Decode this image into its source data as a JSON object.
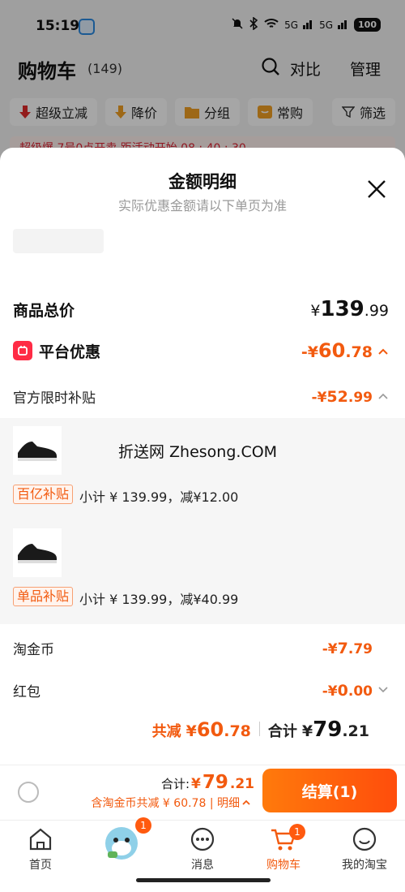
{
  "status_bar": {
    "time": "15:19",
    "battery": "100",
    "network_1": "5G",
    "network_2": "5G"
  },
  "cart_header": {
    "title": "购物车",
    "count": "(149)",
    "compare": "对比",
    "manage": "管理"
  },
  "filters": [
    {
      "label": "超级立减",
      "icon": "arrow-down-icon",
      "color": "#e02a2a"
    },
    {
      "label": "降价",
      "icon": "price-down-icon",
      "color": "#f2a024"
    },
    {
      "label": "分组",
      "icon": "folder-icon",
      "color": "#f2a024"
    },
    {
      "label": "常购",
      "icon": "frequent-icon",
      "color": "#f2a024"
    },
    {
      "label": "筛选",
      "icon": "filter-icon",
      "color": "#333333"
    }
  ],
  "promo_strip": {
    "text": "超级爆 7号0点开卖 距活动开始 08 : 40 : 30"
  },
  "sheet": {
    "title": "金额明细",
    "subtitle": "实际优惠金额请以下单页为准",
    "goods_total": {
      "label": "商品总价",
      "currency": "¥",
      "integer": "139",
      "decimal": ".99"
    },
    "platform_discount": {
      "label": "平台优惠",
      "sign": "-¥",
      "integer": "60",
      "decimal": ".78"
    },
    "official_subsidy": {
      "label": "官方限时补贴",
      "sign": "-¥",
      "integer": "52",
      "decimal": ".99"
    },
    "items": [
      {
        "tag": "百亿补贴",
        "text": "小计 ¥ 139.99，减¥12.00"
      },
      {
        "tag": "单品补贴",
        "text": "小计 ¥ 139.99，减¥40.99"
      }
    ],
    "watermark": "折送网 Zhesong.COM",
    "taojinbi": {
      "label": "淘金币",
      "sign": "-¥",
      "integer": "7",
      "decimal": ".79"
    },
    "red_packet": {
      "label": "红包",
      "sign": "-¥",
      "integer": "0",
      "decimal": ".00"
    },
    "totals": {
      "reduce_label": "共减",
      "reduce_currency": "¥",
      "reduce_integer": "60",
      "reduce_decimal": ".78",
      "sum_label": "合计",
      "sum_currency": "¥",
      "sum_integer": "79",
      "sum_decimal": ".21"
    }
  },
  "checkout": {
    "total_label": "合计:",
    "total_currency": "¥",
    "total_integer": "79",
    "total_decimal": ".21",
    "detail": "含淘金币共减 ¥ 60.78 | 明细",
    "button": "结算(1)"
  },
  "tabs": [
    {
      "label": "首页",
      "icon": "home-icon",
      "badge": ""
    },
    {
      "label": "",
      "icon": "mascot-icon",
      "badge": "1"
    },
    {
      "label": "消息",
      "icon": "message-icon",
      "badge": ""
    },
    {
      "label": "购物车",
      "icon": "cart-icon",
      "badge": "1"
    },
    {
      "label": "我的淘宝",
      "icon": "profile-icon",
      "badge": ""
    }
  ],
  "colors": {
    "accent": "#f25a0f",
    "platform_badge": "#ff2b45"
  }
}
